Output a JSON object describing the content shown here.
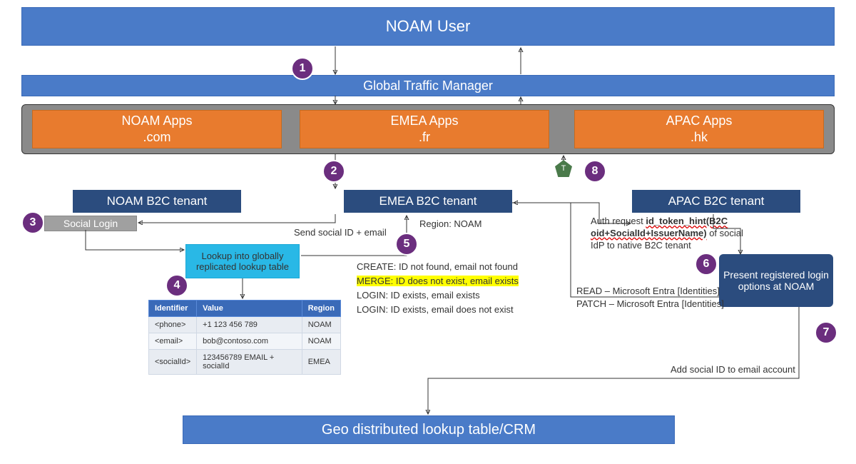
{
  "top_bar": {
    "title": "NOAM User"
  },
  "gtm": {
    "title": "Global Traffic Manager"
  },
  "apps": {
    "noam": {
      "line1": "NOAM Apps",
      "line2": ".com"
    },
    "emea": {
      "line1": "EMEA Apps",
      "line2": ".fr"
    },
    "apac": {
      "line1": "APAC Apps",
      "line2": ".hk"
    }
  },
  "tenants": {
    "noam": "NOAM B2C tenant",
    "emea": "EMEA B2C tenant",
    "apac": "APAC B2C tenant"
  },
  "social_login": "Social Login",
  "lookup_box": "Lookup into globally replicated lookup table",
  "present_box": "Present registered login options at NOAM",
  "bottom_bar": "Geo distributed lookup table/CRM",
  "steps": {
    "1": "1",
    "2": "2",
    "3": "3",
    "4": "4",
    "5": "5",
    "6": "6",
    "7": "7",
    "8": "8"
  },
  "pentagon": "T",
  "labels": {
    "send_social": "Send social ID + email",
    "region_noam": "Region: NOAM",
    "create": "CREATE: ID not found, email not found",
    "merge": "MERGE: ID does not exist, email exists",
    "login1": "LOGIN: ID exists, email exists",
    "login2": "LOGIN: ID exists, email does not exist",
    "auth1": "Auth request ",
    "auth_bold": "id_token_hint(B2C oid+SocialId+IssuerName)",
    "auth2": " of social IdP to native B2C tenant",
    "read": "READ – Microsoft Entra [Identities]",
    "patch": "PATCH – Microsoft Entra [Identities]",
    "add_social": "Add social ID to email account"
  },
  "table": {
    "headers": {
      "id": "Identifier",
      "val": "Value",
      "reg": "Region"
    },
    "rows": [
      {
        "id": "<phone>",
        "val": "+1 123 456 789",
        "reg": "NOAM"
      },
      {
        "id": "<email>",
        "val": "bob@contoso.com",
        "reg": "NOAM"
      },
      {
        "id": "<socialId>",
        "val": "123456789 EMAIL + socialId",
        "reg": "EMEA"
      }
    ]
  }
}
